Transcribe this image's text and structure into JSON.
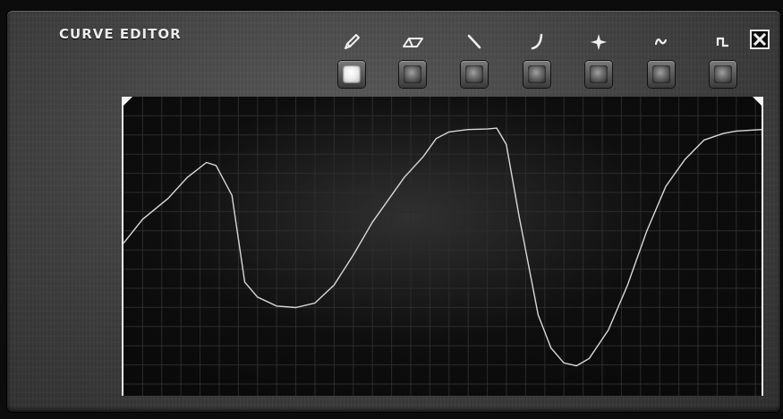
{
  "window": {
    "title": "CURVE EDITOR"
  },
  "toolbar": {
    "tools": [
      {
        "name": "pencil",
        "icon": "pencil-icon",
        "active": true
      },
      {
        "name": "eraser",
        "icon": "eraser-icon",
        "active": false
      },
      {
        "name": "line",
        "icon": "line-icon",
        "active": false
      },
      {
        "name": "curve",
        "icon": "curve-icon",
        "active": false
      },
      {
        "name": "spike",
        "icon": "spike-icon",
        "active": false
      },
      {
        "name": "sine",
        "icon": "sine-wave-icon",
        "active": false
      },
      {
        "name": "square",
        "icon": "square-wave-icon",
        "active": false
      }
    ],
    "close_icon": "close-icon"
  },
  "colors": {
    "panel": "#444444",
    "graph_bg": "#0a0a0a",
    "grid": "#2c2c2c",
    "curve": "#d8d8d8",
    "accent": "#f0f0f0"
  },
  "curve": {
    "points": [
      [
        0.0,
        0.49
      ],
      [
        0.03,
        0.41
      ],
      [
        0.07,
        0.34
      ],
      [
        0.1,
        0.27
      ],
      [
        0.13,
        0.22
      ],
      [
        0.145,
        0.23
      ],
      [
        0.17,
        0.33
      ],
      [
        0.19,
        0.62
      ],
      [
        0.21,
        0.67
      ],
      [
        0.24,
        0.7
      ],
      [
        0.27,
        0.705
      ],
      [
        0.3,
        0.69
      ],
      [
        0.33,
        0.63
      ],
      [
        0.36,
        0.53
      ],
      [
        0.39,
        0.42
      ],
      [
        0.42,
        0.33
      ],
      [
        0.44,
        0.27
      ],
      [
        0.47,
        0.2
      ],
      [
        0.49,
        0.14
      ],
      [
        0.51,
        0.118
      ],
      [
        0.54,
        0.11
      ],
      [
        0.57,
        0.108
      ],
      [
        0.585,
        0.105
      ],
      [
        0.6,
        0.16
      ],
      [
        0.62,
        0.4
      ],
      [
        0.65,
        0.73
      ],
      [
        0.67,
        0.84
      ],
      [
        0.69,
        0.89
      ],
      [
        0.71,
        0.9
      ],
      [
        0.73,
        0.875
      ],
      [
        0.76,
        0.78
      ],
      [
        0.79,
        0.63
      ],
      [
        0.82,
        0.45
      ],
      [
        0.85,
        0.3
      ],
      [
        0.88,
        0.21
      ],
      [
        0.91,
        0.145
      ],
      [
        0.94,
        0.123
      ],
      [
        0.96,
        0.115
      ],
      [
        1.0,
        0.11
      ]
    ]
  }
}
